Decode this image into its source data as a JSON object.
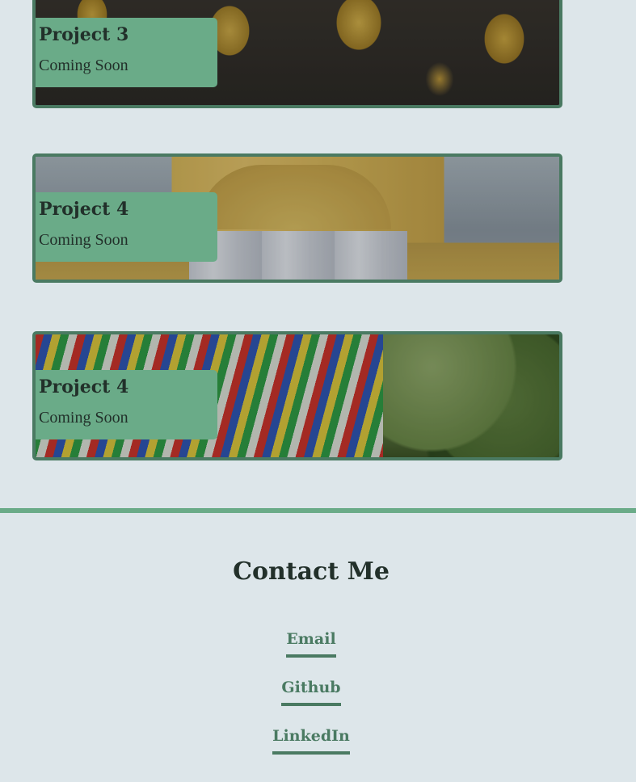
{
  "projects": [
    {
      "title": "Project 3",
      "subtitle": "Coming Soon"
    },
    {
      "title": "Project 4",
      "subtitle": "Coming Soon"
    },
    {
      "title": "Project 4",
      "subtitle": "Coming Soon"
    }
  ],
  "contact": {
    "title": "Contact Me",
    "links": [
      "Email",
      "Github",
      "LinkedIn"
    ]
  },
  "colors": {
    "background": "#dde6ea",
    "accent": "#6aab88",
    "accent_dark": "#4a7a62",
    "text": "#22302a"
  }
}
